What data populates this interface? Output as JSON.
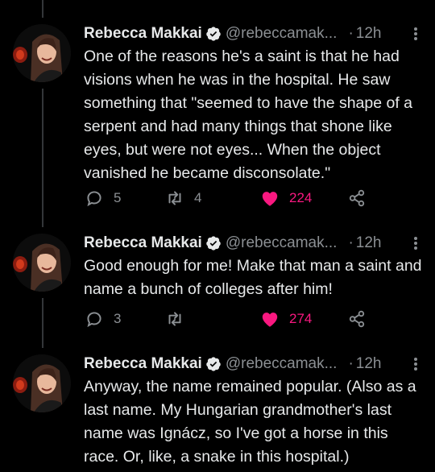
{
  "author": {
    "name": "Rebecca Makkai",
    "handle": "@rebeccamak...",
    "verified": true
  },
  "colors": {
    "background": "#000000",
    "text": "#e7e9ea",
    "secondary": "#8b8f93",
    "like": "#f91880",
    "verified_badge": "#e7e9ea"
  },
  "tweets": [
    {
      "time": "12h",
      "separator": "·",
      "text": "One of the reasons he's a saint is that he had visions when he was in the hospital. He saw something that \"seemed to have the shape of a serpent and had many things that shone like eyes, but were not eyes... When the object vanished he became disconsolate.\"",
      "replies": "5",
      "retweets": "4",
      "likes": "224",
      "liked": true
    },
    {
      "time": "12h",
      "separator": "·",
      "text": "Good enough for me! Make that man a saint and name a bunch of colleges after him!",
      "replies": "3",
      "retweets": "",
      "likes": "274",
      "liked": true
    },
    {
      "time": "12h",
      "separator": "·",
      "text": "Anyway, the name remained popular. (Also as a last name. My Hungarian grandmother's last name was Ignácz, so I've got a horse in this race. Or, like, a snake in this hospital.)",
      "liked": false
    }
  ],
  "icons": {
    "reply": "reply-icon",
    "retweet": "retweet-icon",
    "like": "heart-icon",
    "share": "share-icon",
    "more": "more-icon",
    "verified": "verified-badge-icon"
  }
}
